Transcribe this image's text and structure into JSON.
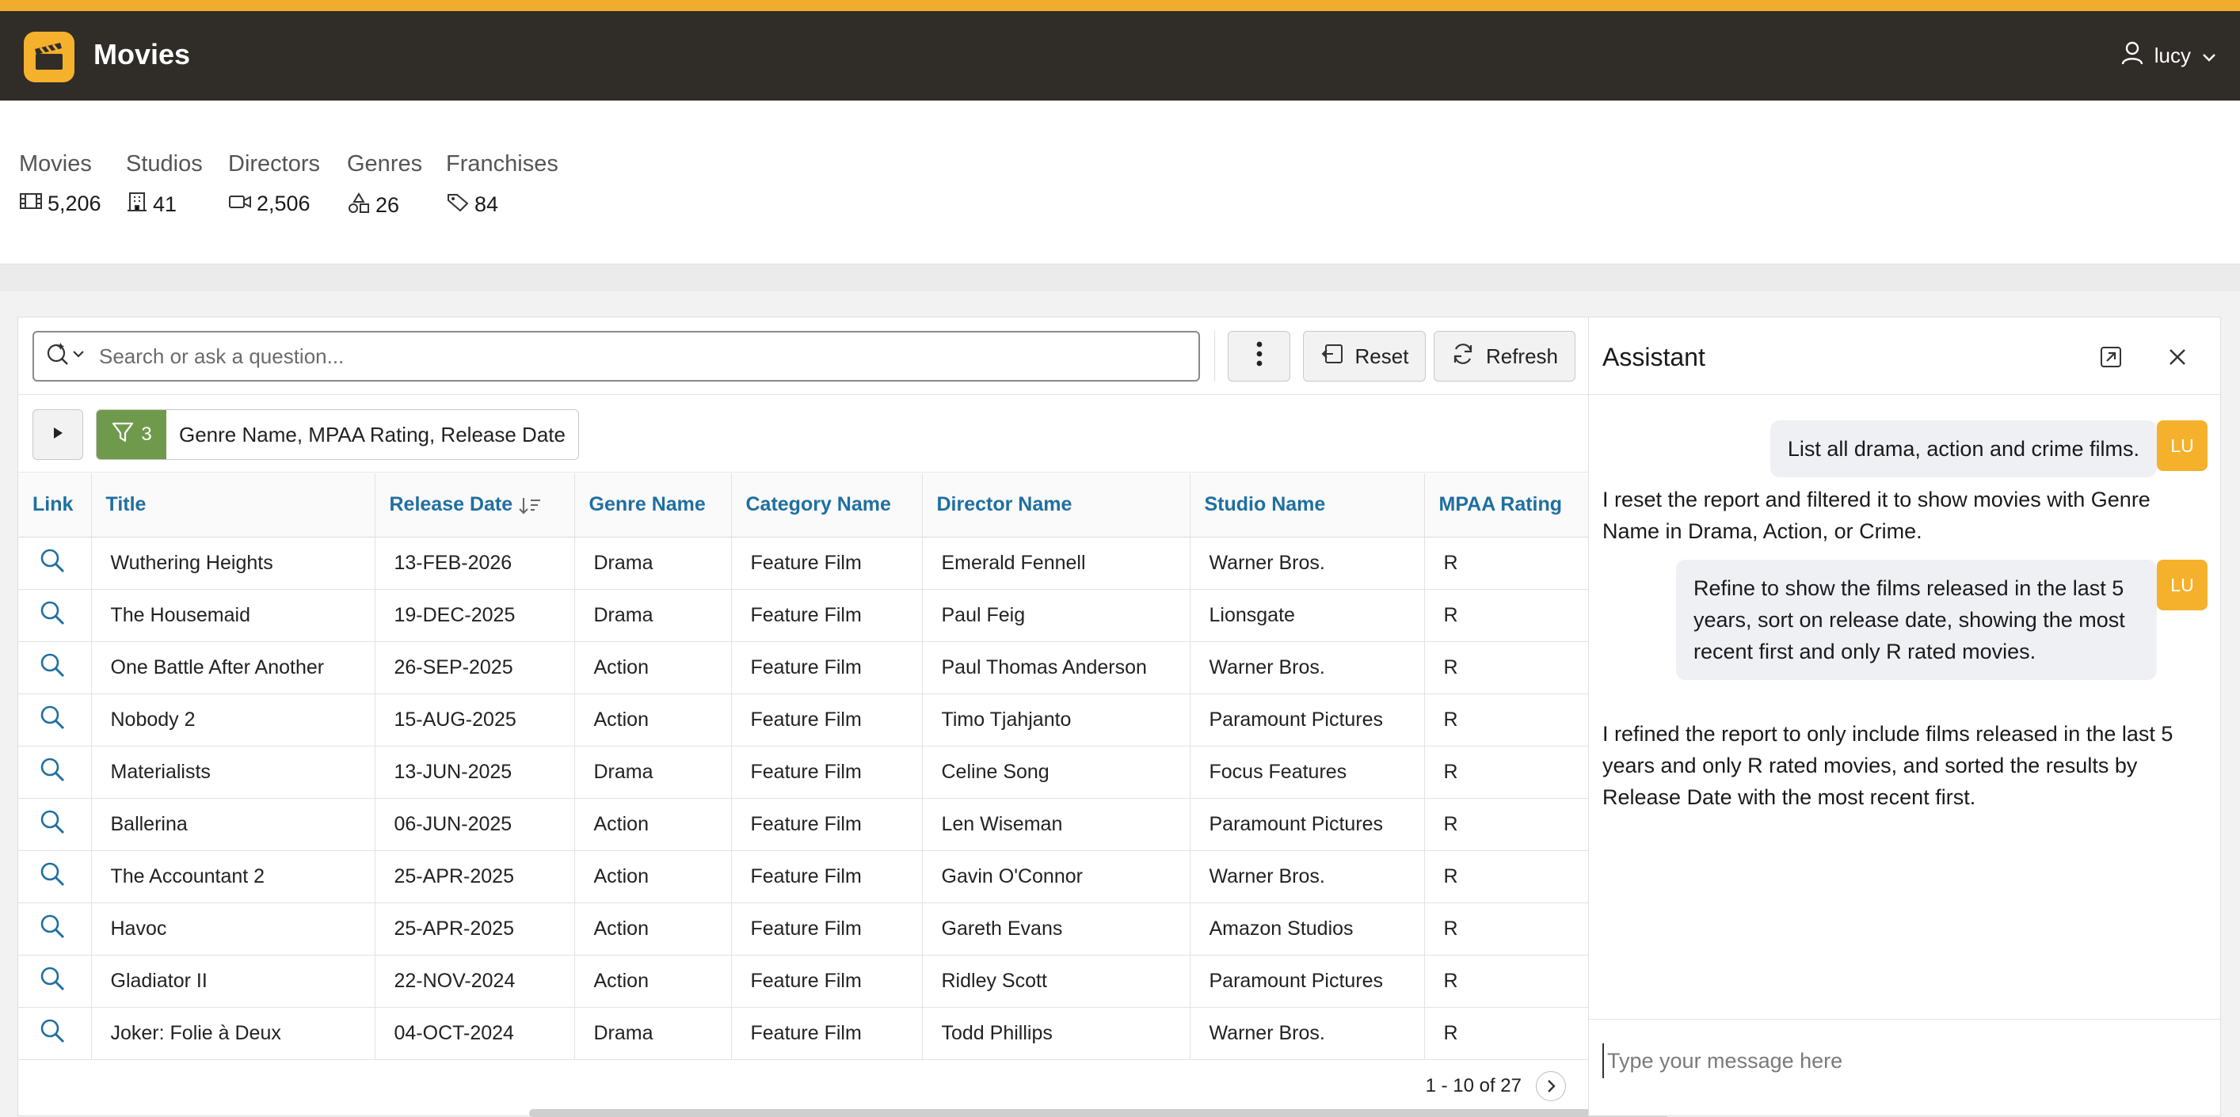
{
  "app": {
    "title": "Movies",
    "user_name": "lucy"
  },
  "stats": [
    {
      "label": "Movies",
      "value": "5,206",
      "icon": "film-icon"
    },
    {
      "label": "Studios",
      "value": "41",
      "icon": "building-icon"
    },
    {
      "label": "Directors",
      "value": "2,506",
      "icon": "video-camera-icon"
    },
    {
      "label": "Genres",
      "value": "26",
      "icon": "shapes-icon"
    },
    {
      "label": "Franchises",
      "value": "84",
      "icon": "tag-icon"
    }
  ],
  "toolbar": {
    "search_placeholder": "Search or ask a question...",
    "reset_label": "Reset",
    "refresh_label": "Refresh"
  },
  "filter": {
    "count": "3",
    "summary": "Genre Name, MPAA Rating, Release Date"
  },
  "table": {
    "columns": [
      "Link",
      "Title",
      "Release Date",
      "Genre Name",
      "Category Name",
      "Director Name",
      "Studio Name",
      "MPAA Rating"
    ],
    "rows": [
      [
        "Wuthering Heights",
        "13-FEB-2026",
        "Drama",
        "Feature Film",
        "Emerald Fennell",
        "Warner Bros.",
        "R"
      ],
      [
        "The Housemaid",
        "19-DEC-2025",
        "Drama",
        "Feature Film",
        "Paul Feig",
        "Lionsgate",
        "R"
      ],
      [
        "One Battle After Another",
        "26-SEP-2025",
        "Action",
        "Feature Film",
        "Paul Thomas Anderson",
        "Warner Bros.",
        "R"
      ],
      [
        "Nobody 2",
        "15-AUG-2025",
        "Action",
        "Feature Film",
        "Timo Tjahjanto",
        "Paramount Pictures",
        "R"
      ],
      [
        "Materialists",
        "13-JUN-2025",
        "Drama",
        "Feature Film",
        "Celine Song",
        "Focus Features",
        "R"
      ],
      [
        "Ballerina",
        "06-JUN-2025",
        "Action",
        "Feature Film",
        "Len Wiseman",
        "Paramount Pictures",
        "R"
      ],
      [
        "The Accountant 2",
        "25-APR-2025",
        "Action",
        "Feature Film",
        "Gavin O'Connor",
        "Warner Bros.",
        "R"
      ],
      [
        "Havoc",
        "25-APR-2025",
        "Action",
        "Feature Film",
        "Gareth Evans",
        "Amazon Studios",
        "R"
      ],
      [
        "Gladiator II",
        "22-NOV-2024",
        "Action",
        "Feature Film",
        "Ridley Scott",
        "Paramount Pictures",
        "R"
      ],
      [
        "Joker: Folie à Deux",
        "04-OCT-2024",
        "Drama",
        "Feature Film",
        "Todd Phillips",
        "Warner Bros.",
        "R"
      ]
    ],
    "pagination": "1 - 10 of 27"
  },
  "assistant": {
    "title": "Assistant",
    "avatar_initials": "LU",
    "messages": [
      {
        "role": "user",
        "text": "List all drama, action and crime films."
      },
      {
        "role": "assistant",
        "text": "I reset the report and filtered it to show movies with Genre Name in Drama, Action, or Crime."
      },
      {
        "role": "user",
        "text": "Refine to show the films released in the last 5 years, sort on release date, showing the most recent first and only R rated movies."
      },
      {
        "role": "assistant",
        "text": "I refined the report to only include films released in the last 5 years and only R rated movies, and sorted the results by Release Date with the most recent first."
      }
    ],
    "composer_placeholder": "Type your message here"
  },
  "colors": {
    "accent": "#f0ac2c",
    "header_bg": "#302c28",
    "link_blue": "#1f6fa0",
    "filter_green": "#6f9a4b"
  }
}
